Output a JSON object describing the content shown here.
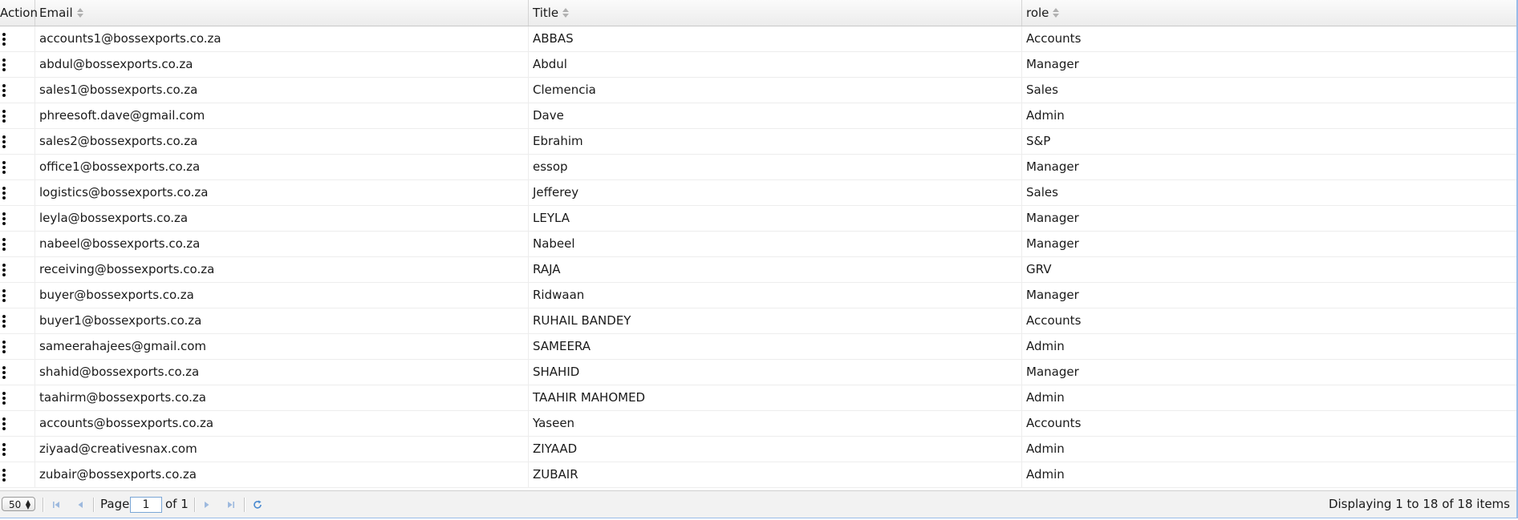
{
  "header": {
    "action": "Action",
    "email": "Email",
    "title": "Title",
    "role": "role"
  },
  "rows": [
    {
      "email": "accounts1@bossexports.co.za",
      "title": "ABBAS",
      "role": "Accounts"
    },
    {
      "email": "abdul@bossexports.co.za",
      "title": "Abdul",
      "role": "Manager"
    },
    {
      "email": "sales1@bossexports.co.za",
      "title": "Clemencia",
      "role": "Sales"
    },
    {
      "email": "phreesoft.dave@gmail.com",
      "title": "Dave",
      "role": "Admin"
    },
    {
      "email": "sales2@bossexports.co.za",
      "title": "Ebrahim",
      "role": "S&P"
    },
    {
      "email": "office1@bossexports.co.za",
      "title": "essop",
      "role": "Manager"
    },
    {
      "email": "logistics@bossexports.co.za",
      "title": "Jefferey",
      "role": "Sales"
    },
    {
      "email": "leyla@bossexports.co.za",
      "title": "LEYLA",
      "role": "Manager"
    },
    {
      "email": "nabeel@bossexports.co.za",
      "title": "Nabeel",
      "role": "Manager"
    },
    {
      "email": "receiving@bossexports.co.za",
      "title": "RAJA",
      "role": "GRV"
    },
    {
      "email": "buyer@bossexports.co.za",
      "title": "Ridwaan",
      "role": "Manager"
    },
    {
      "email": "buyer1@bossexports.co.za",
      "title": "RUHAIL BANDEY",
      "role": "Accounts"
    },
    {
      "email": "sameerahajees@gmail.com",
      "title": "SAMEERA",
      "role": "Admin"
    },
    {
      "email": "shahid@bossexports.co.za",
      "title": "SHAHID",
      "role": "Manager"
    },
    {
      "email": "taahirm@bossexports.co.za",
      "title": "TAAHIR MAHOMED",
      "role": "Admin"
    },
    {
      "email": "accounts@bossexports.co.za",
      "title": "Yaseen",
      "role": "Accounts"
    },
    {
      "email": "ziyaad@creativesnax.com",
      "title": "ZIYAAD",
      "role": "Admin"
    },
    {
      "email": "zubair@bossexports.co.za",
      "title": "ZUBAIR",
      "role": "Admin"
    }
  ],
  "pager": {
    "page_size": "50",
    "page_label": "Page",
    "page_value": "1",
    "of_label": "of 1",
    "display_text": "Displaying 1 to 18 of 18 items"
  },
  "icons": {
    "row_action": "more-vertical-icon",
    "first": "first-page-icon",
    "prev": "previous-page-icon",
    "next": "next-page-icon",
    "last": "last-page-icon",
    "refresh": "refresh-icon"
  },
  "colors": {
    "accent": "#5b9bd5",
    "border": "#99bbe8",
    "disabled_nav": "#9db9de"
  }
}
